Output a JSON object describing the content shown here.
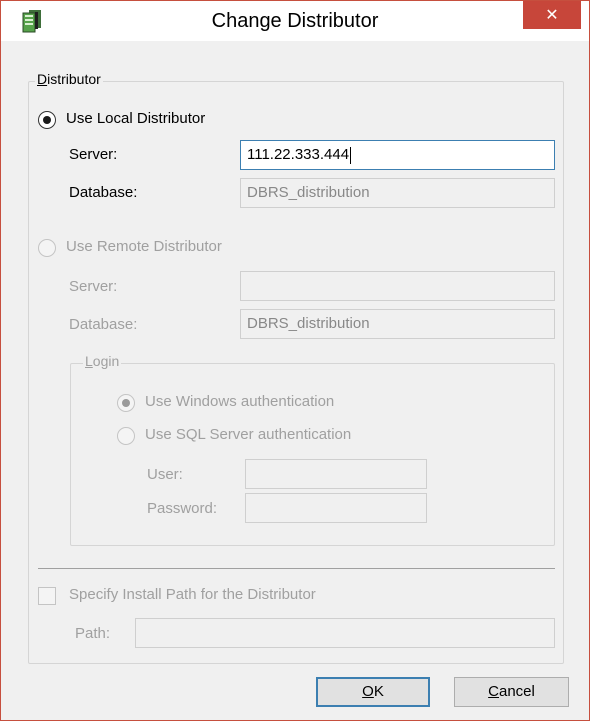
{
  "window": {
    "title": "Change Distributor",
    "close_glyph": "✕"
  },
  "distributor_group": {
    "legend_prefix": "D",
    "legend_rest": "istributor",
    "local": {
      "label": "Use Local Distributor",
      "checked": true,
      "server_label": "Server:",
      "server_value": "111.22.333.444",
      "database_label": "Database:",
      "database_value": "DBRS_distribution"
    },
    "remote": {
      "label": "Use Remote Distributor",
      "checked": false,
      "server_label": "Server:",
      "server_value": "",
      "database_label": "Database:",
      "database_value": "DBRS_distribution"
    },
    "login_group": {
      "legend_prefix": "L",
      "legend_rest": "ogin",
      "windows_auth_label": "Use Windows authentication",
      "sql_auth_label": "Use SQL Server authentication",
      "user_label": "User:",
      "user_value": "",
      "password_label": "Password:",
      "password_value": ""
    },
    "install_path": {
      "checkbox_label": "Specify Install Path for the Distributor",
      "path_label": "Path:",
      "path_value": ""
    }
  },
  "buttons": {
    "ok_prefix": "O",
    "ok_rest": "K",
    "cancel_prefix": "C",
    "cancel_rest": "ancel"
  },
  "colors": {
    "accent_border": "#3c7fb1",
    "close_red": "#c7463a",
    "disabled_text": "#a0a0a0"
  },
  "icons": {
    "app": "database-server-icon",
    "close": "close-icon"
  }
}
